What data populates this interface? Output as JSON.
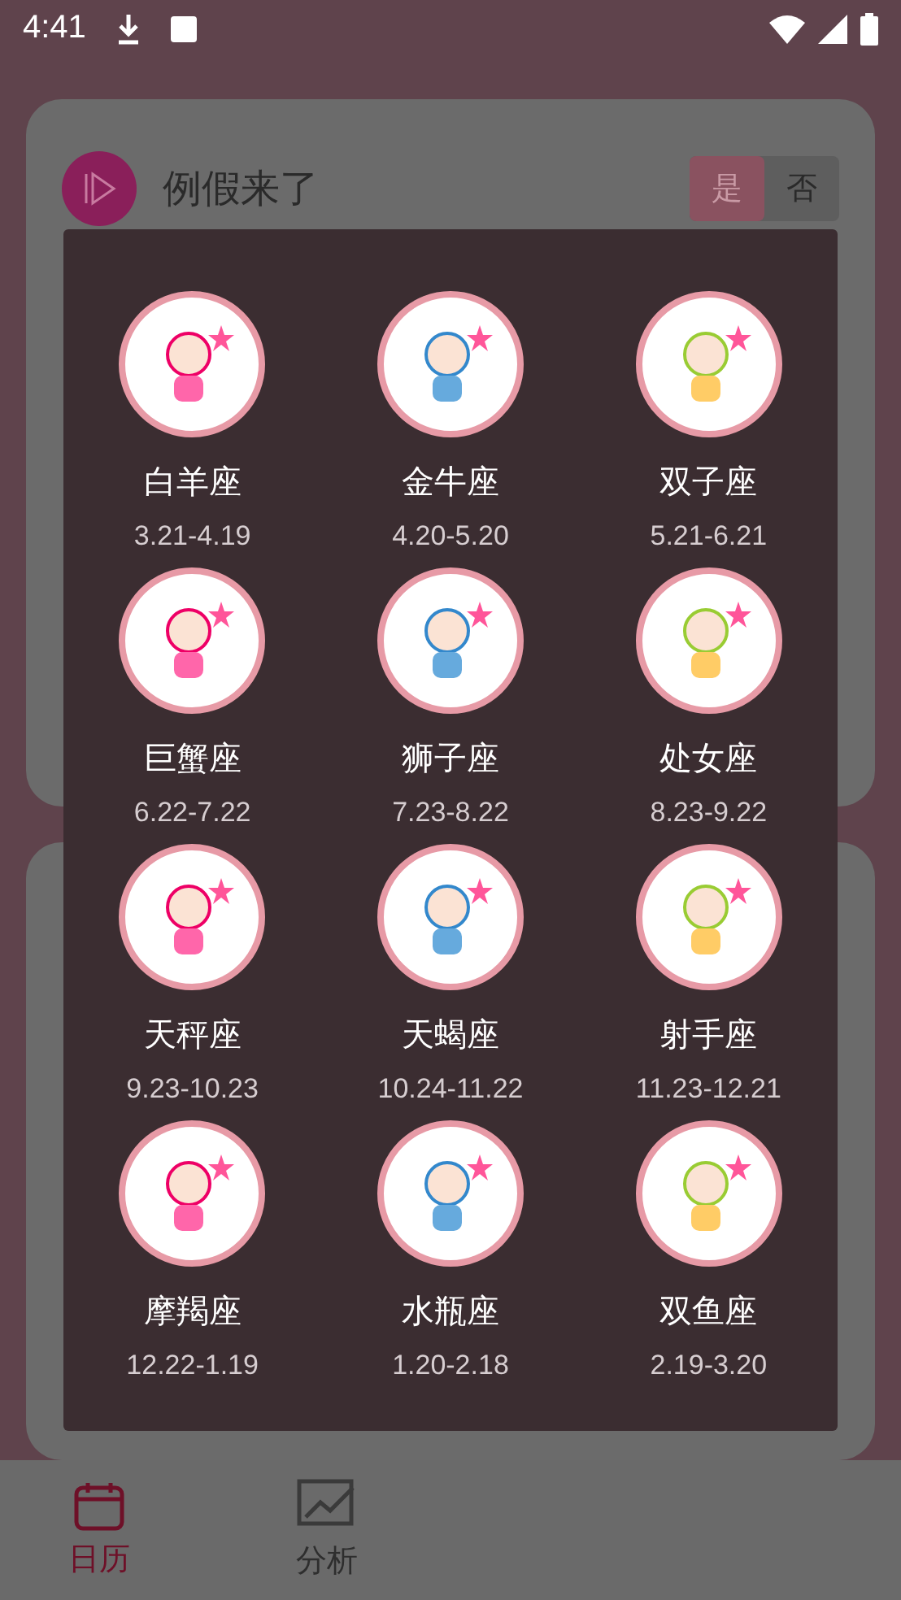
{
  "status_bar": {
    "time": "4:41"
  },
  "background_card": {
    "title": "例假来了",
    "toggle": [
      {
        "label": "是",
        "selected": true
      },
      {
        "label": "否",
        "selected": false
      }
    ]
  },
  "zodiac_dialog": {
    "signs": [
      {
        "name": "白羊座",
        "dates": "3.21-4.19"
      },
      {
        "name": "金牛座",
        "dates": "4.20-5.20"
      },
      {
        "name": "双子座",
        "dates": "5.21-6.21"
      },
      {
        "name": "巨蟹座",
        "dates": "6.22-7.22"
      },
      {
        "name": "狮子座",
        "dates": "7.23-8.22"
      },
      {
        "name": "处女座",
        "dates": "8.23-9.22"
      },
      {
        "name": "天秤座",
        "dates": "9.23-10.23"
      },
      {
        "name": "天蝎座",
        "dates": "10.24-11.22"
      },
      {
        "name": "射手座",
        "dates": "11.23-12.21"
      },
      {
        "name": "摩羯座",
        "dates": "12.22-1.19"
      },
      {
        "name": "水瓶座",
        "dates": "1.20-2.18"
      },
      {
        "name": "双鱼座",
        "dates": "2.19-3.20"
      }
    ]
  },
  "bottom_nav": [
    {
      "label": "日历",
      "kind": "calendar",
      "selected": true
    },
    {
      "label": "分析",
      "kind": "chart",
      "selected": false
    }
  ]
}
